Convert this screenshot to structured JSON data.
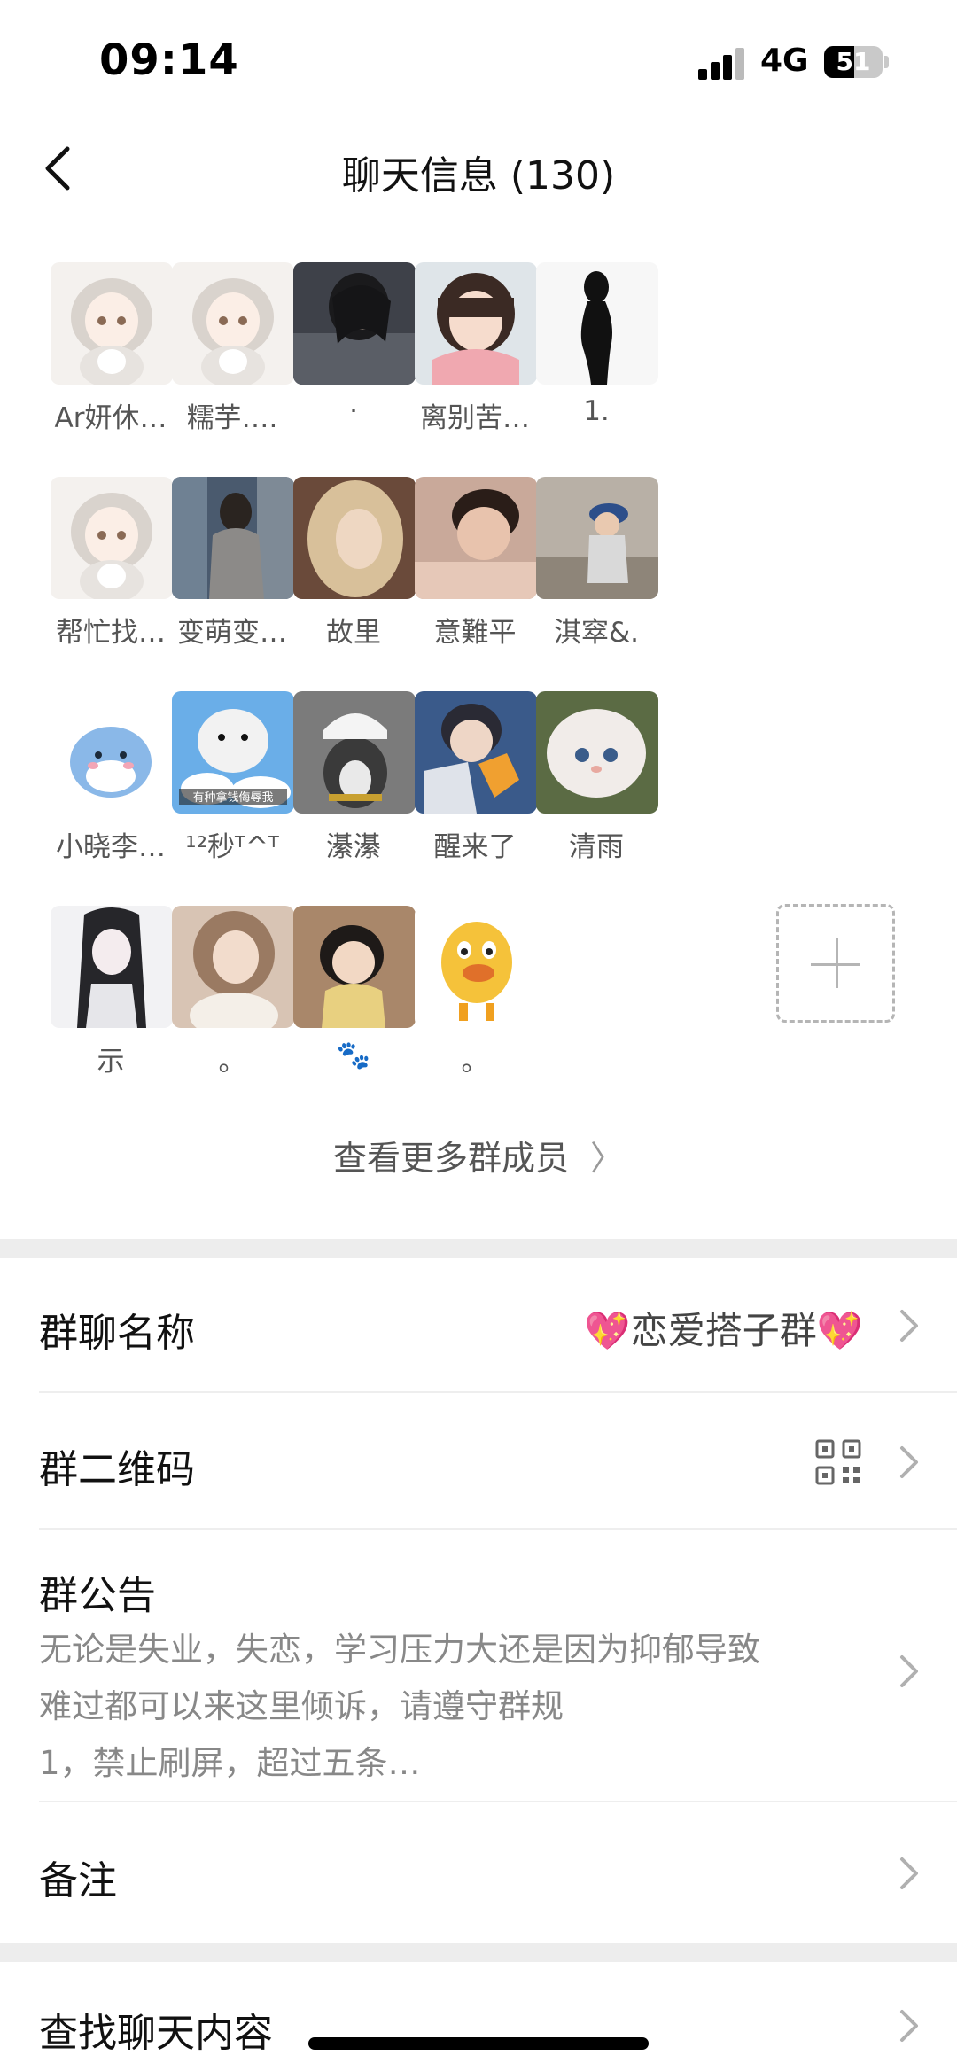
{
  "status_bar": {
    "time": "09:14",
    "network": "4G",
    "battery": "51",
    "battery_level": 0.51
  },
  "nav": {
    "title": "聊天信息 (130)"
  },
  "members": [
    {
      "name": "Ar妍休…",
      "avatar": "anime-girl-cat"
    },
    {
      "name": "糯芋….",
      "avatar": "anime-girl-cat"
    },
    {
      "name": "·",
      "avatar": "photo-dark-hair"
    },
    {
      "name": "离别苦…",
      "avatar": "photo-girl-scarf"
    },
    {
      "name": "1.",
      "avatar": "silhouette"
    },
    {
      "name": "帮忙找…",
      "avatar": "anime-girl-cat"
    },
    {
      "name": "变萌变…",
      "avatar": "photo-girl-street"
    },
    {
      "name": "故里",
      "avatar": "photo-blonde"
    },
    {
      "name": "意難平",
      "avatar": "photo-boy"
    },
    {
      "name": "淇窣&.",
      "avatar": "photo-girl-cap"
    },
    {
      "name": "小晓李…",
      "avatar": "cartoon-shark"
    },
    {
      "name": "¹²秒ᵀ^ᵀ",
      "avatar": "meme-bear"
    },
    {
      "name": "濝濝",
      "avatar": "photo-dog-helmet"
    },
    {
      "name": "醒来了",
      "avatar": "photo-boy-leaf"
    },
    {
      "name": "清雨",
      "avatar": "photo-white-cat"
    },
    {
      "name": "示",
      "avatar": "anime-girl-black-hair"
    },
    {
      "name": "。",
      "avatar": "photo-girl-soft"
    },
    {
      "name": "🐾",
      "avatar": "photo-kid"
    },
    {
      "name": "。",
      "avatar": "cartoon-duck"
    }
  ],
  "meme_caption": "有种拿钱侮辱我",
  "view_more": {
    "label": "查看更多群成员"
  },
  "settings": {
    "group_name_label": "群聊名称",
    "group_name_value": "💖恋爱搭子群💖",
    "qr_label": "群二维码",
    "notice_label": "群公告",
    "notice_text": "无论是失业，失恋，学习压力大还是因为抑郁导致\n难过都可以来这里倾诉，请遵守群规\n1，禁止刷屏，超过五条…",
    "remark_label": "备注",
    "search_label": "查找聊天内容"
  },
  "icons": {
    "back": "chevron-left-icon",
    "chevron": "chevron-right-icon",
    "qr": "qr-code-icon",
    "add": "plus-icon"
  },
  "colors": {
    "background": "#ffffff",
    "separator": "#ededed",
    "secondary_text": "#888888"
  }
}
